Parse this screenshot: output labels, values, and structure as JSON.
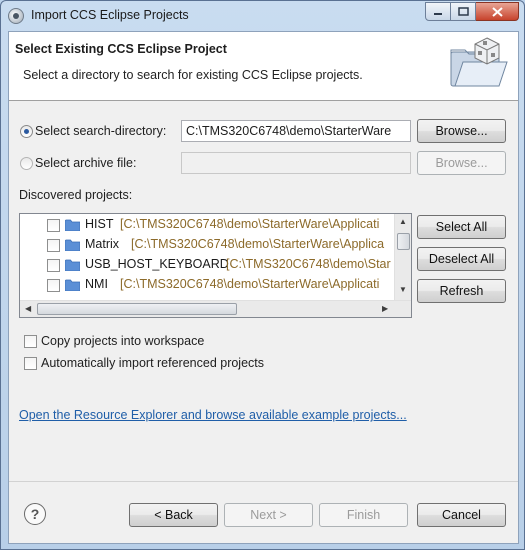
{
  "window": {
    "title": "Import CCS Eclipse Projects"
  },
  "banner": {
    "title": "Select Existing CCS Eclipse Project",
    "message": "Select a directory to search for existing CCS Eclipse projects."
  },
  "source": {
    "search_dir_label": "Select search-directory:",
    "search_dir_value": "C:\\TMS320C6748\\demo\\StarterWare",
    "search_dir_selected": true,
    "archive_label": "Select archive file:",
    "archive_value": "",
    "browse_label": "Browse...",
    "browse_archive_label": "Browse..."
  },
  "projects": {
    "label": "Discovered projects:",
    "items": [
      {
        "name": "HIST",
        "path": "[C:\\TMS320C6748\\demo\\StarterWare\\Applicati",
        "checked": false
      },
      {
        "name": "Matrix",
        "path": "[C:\\TMS320C6748\\demo\\StarterWare\\Applica",
        "checked": false
      },
      {
        "name": "USB_HOST_KEYBOARD",
        "path": "[C:\\TMS320C6748\\demo\\Star",
        "checked": false
      },
      {
        "name": "NMI",
        "path": "[C:\\TMS320C6748\\demo\\StarterWare\\Applicati",
        "checked": false
      }
    ],
    "select_all": "Select All",
    "deselect_all": "Deselect All",
    "refresh": "Refresh"
  },
  "options": {
    "copy_label": "Copy projects into workspace",
    "copy_checked": false,
    "auto_import_label": "Automatically import referenced projects",
    "auto_import_checked": false
  },
  "link_text": "Open the Resource Explorer and browse available example projects...",
  "footer": {
    "back": "< Back",
    "next": "Next >",
    "finish": "Finish",
    "cancel": "Cancel"
  },
  "colors": {
    "link": "#1f5ea8",
    "path_text": "#8c6a2a",
    "folder": "#5b8fd6"
  }
}
